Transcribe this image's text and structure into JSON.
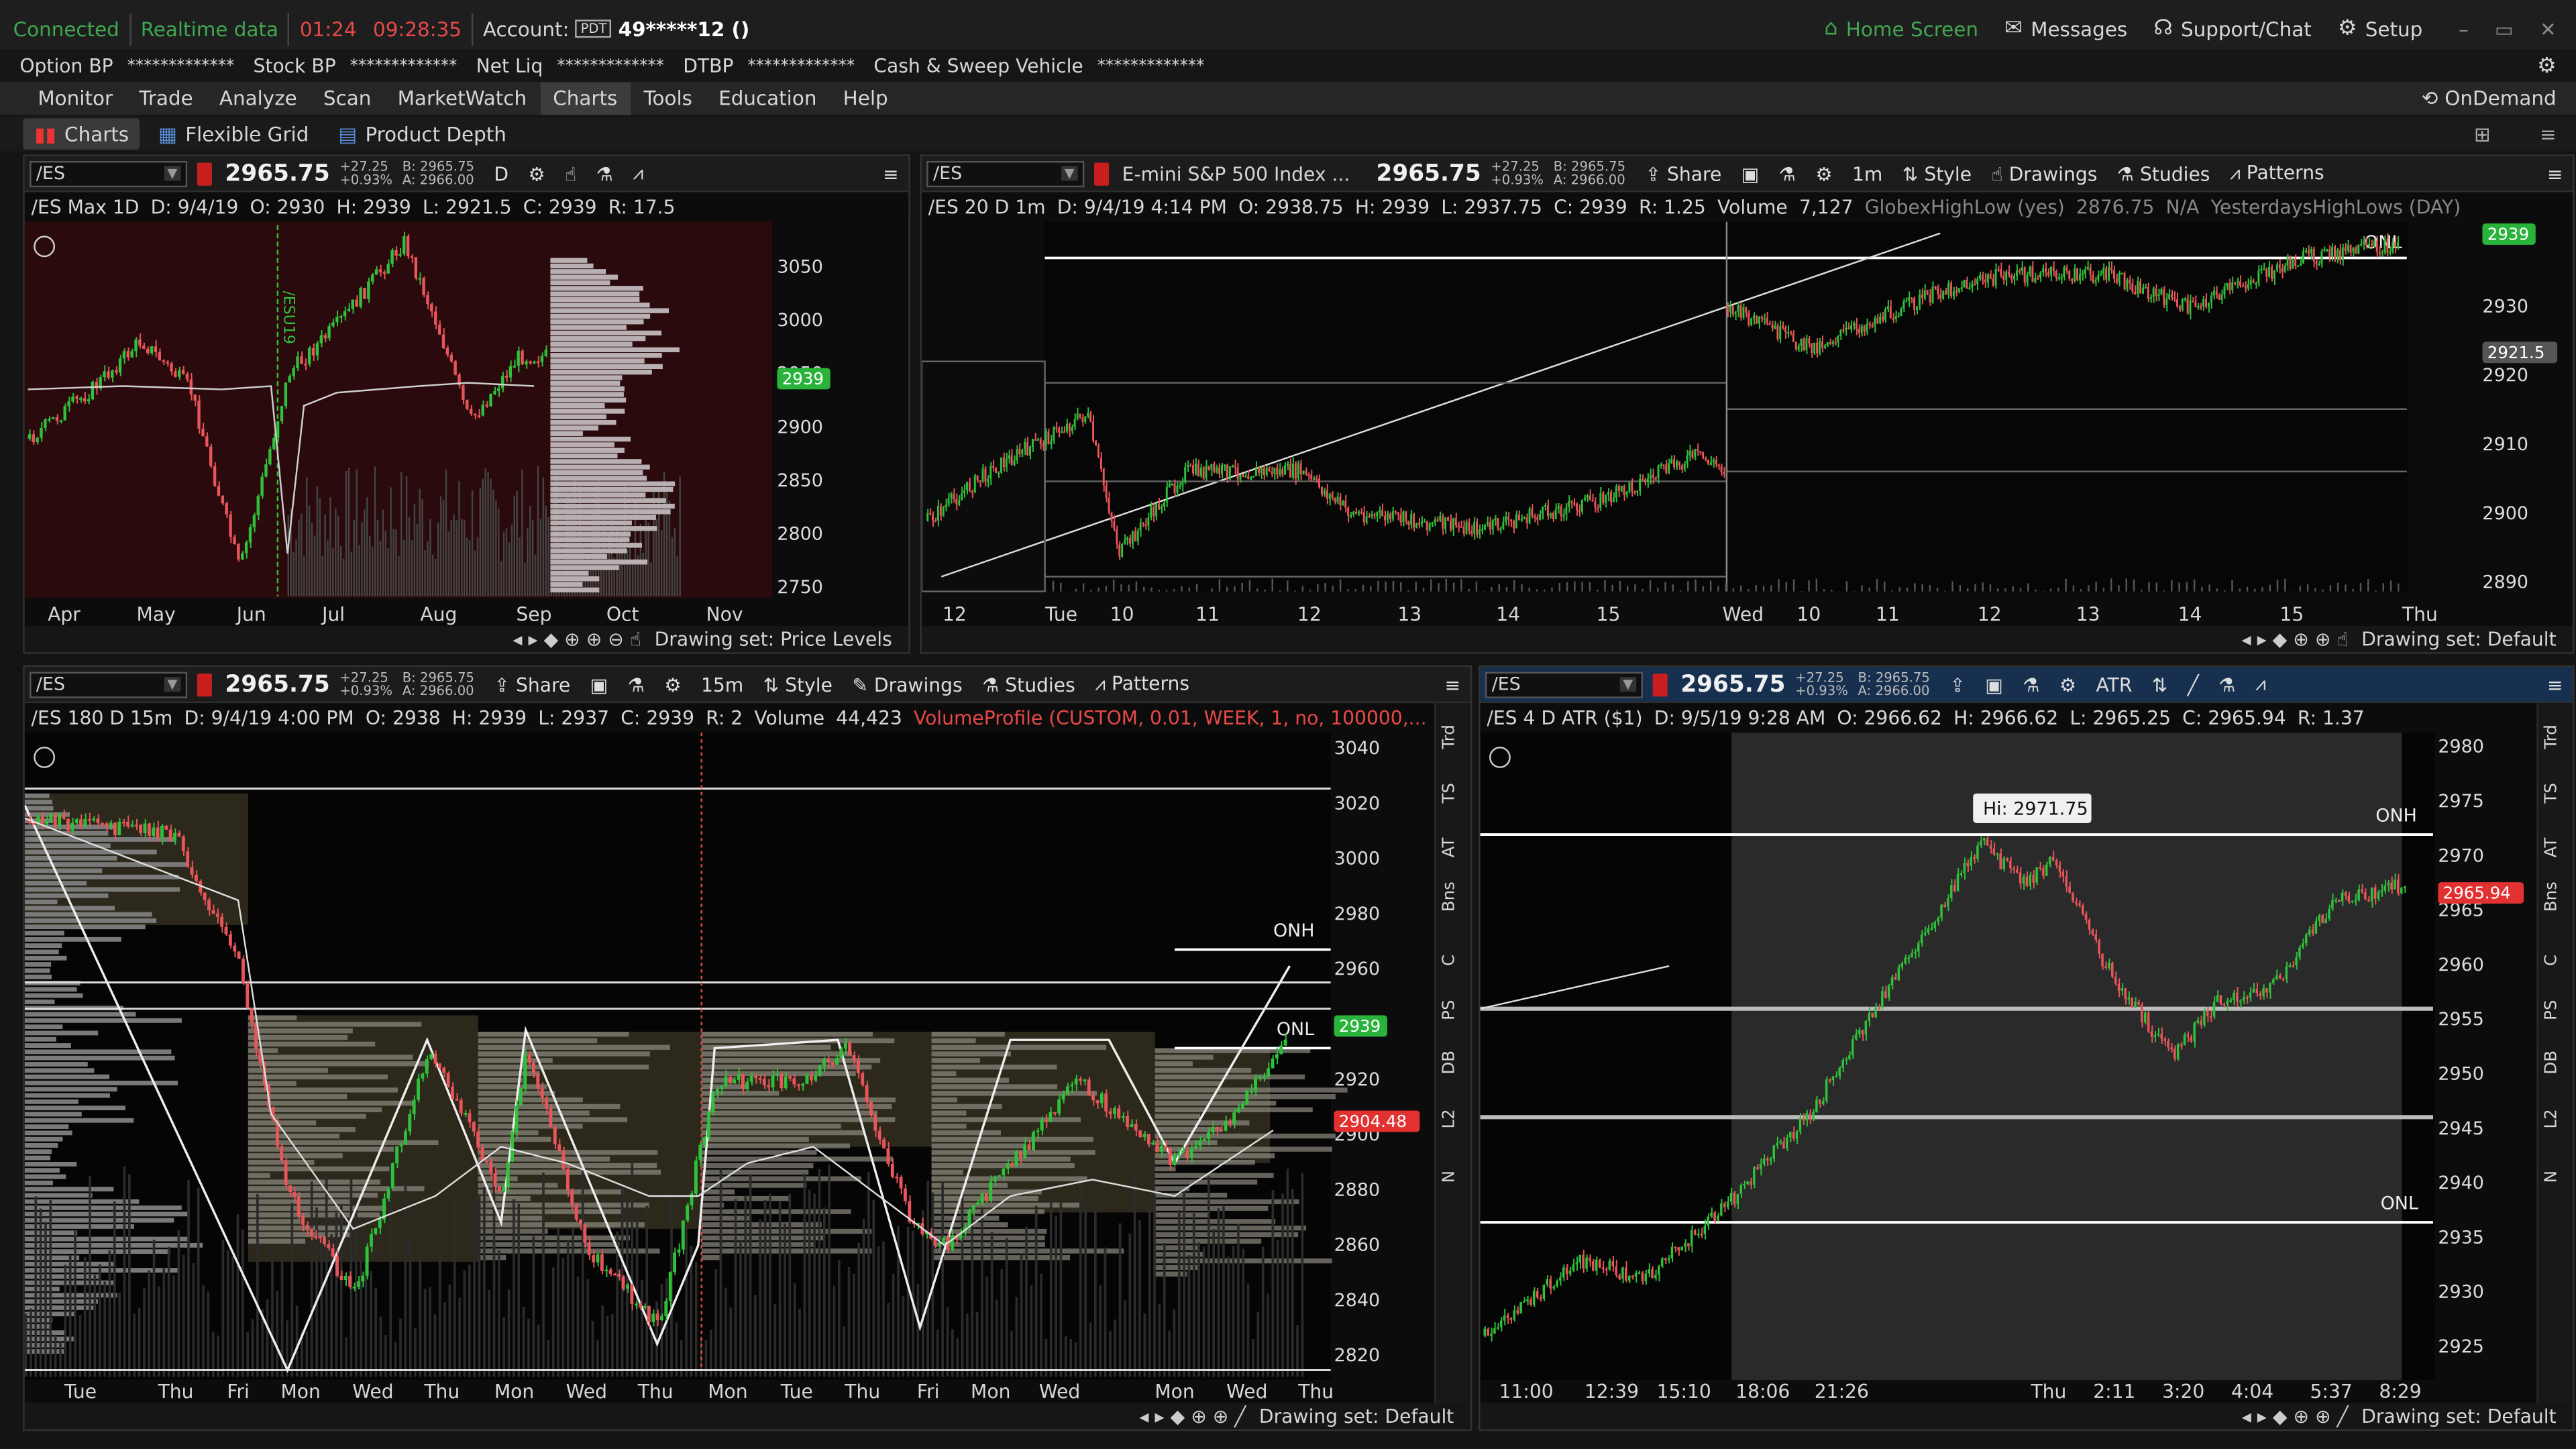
{
  "topbar": {
    "connected": "Connected",
    "realtime": "Realtime data",
    "t1": "01:24",
    "t2": "09:28:35",
    "account_label": "Account:",
    "account_badge": "PDT",
    "account_value": "49*****12 ()",
    "home": "Home Screen",
    "messages": "Messages",
    "support": "Support/Chat",
    "setup": "Setup"
  },
  "acct": {
    "optbp": "Option BP",
    "stockbp": "Stock BP",
    "netliq": "Net Liq",
    "dtbp": "DTBP",
    "cash": "Cash & Sweep Vehicle",
    "mask": "*************"
  },
  "menu": {
    "items": [
      "Monitor",
      "Trade",
      "Analyze",
      "Scan",
      "MarketWatch",
      "Charts",
      "Tools",
      "Education",
      "Help"
    ],
    "selected": "Charts",
    "ondemand": "OnDemand"
  },
  "sub": {
    "charts": "Charts",
    "flex": "Flexible Grid",
    "depth": "Product Depth"
  },
  "common": {
    "symbol": "/ES",
    "price": "2965.75",
    "chg1": "+27.25",
    "chg2": "+0.93%",
    "bid": "B: 2965.75",
    "ask": "A: 2966.00",
    "share": "Share",
    "style": "Style",
    "drawings": "Drawings",
    "studies": "Studies",
    "patterns": "Patterns",
    "drawset_default": "Drawing set: Default",
    "drawset_price": "Drawing set: Price Levels"
  },
  "p1": {
    "agg": "D",
    "info": [
      "/ES Max 1D",
      "D: 9/4/19",
      "O: 2930",
      "H: 2939",
      "L: 2921.5",
      "C: 2939",
      "R: 17.5"
    ],
    "yticks": [
      "3050",
      "3000",
      "2950",
      "2900",
      "2850",
      "2800",
      "2750"
    ],
    "cur": "2939",
    "xticks": [
      "Apr",
      "May",
      "Jun",
      "Jul",
      "Aug",
      "Sep",
      "Oct",
      "Nov"
    ],
    "vlabel": "/ESU19"
  },
  "p2": {
    "desc": "E-mini S&P 500 Index ...",
    "agg": "1m",
    "info": [
      "/ES 20 D 1m",
      "D: 9/4/19 4:14 PM",
      "O: 2938.75",
      "H: 2939",
      "L: 2937.75",
      "C: 2939",
      "R: 1.25",
      "Volume",
      "7,127",
      "GlobexHighLow (yes)",
      "2876.75",
      "N/A",
      "YesterdaysHighLows (DAY)"
    ],
    "yticks": [
      "2930",
      "2920",
      "2910",
      "2900",
      "2890"
    ],
    "cur": "2939",
    "lbl2": "2921.5",
    "onl": "ONL",
    "xticks": [
      "12",
      "Tue",
      "10",
      "11",
      "12",
      "13",
      "14",
      "15",
      "Wed",
      "10",
      "11",
      "12",
      "13",
      "14",
      "15",
      "Thu"
    ]
  },
  "p3": {
    "agg": "15m",
    "info": [
      "/ES 180 D 15m",
      "D: 9/4/19 4:00 PM",
      "O: 2938",
      "H: 2939",
      "L: 2937",
      "C: 2939",
      "R: 2",
      "Volume",
      "44,423"
    ],
    "vp": "VolumeProfile (CUSTOM, 0.01, WEEK, 1, no, 100000,...",
    "yticks": [
      "3040",
      "3020",
      "3000",
      "2980",
      "2960",
      "2940",
      "2920",
      "2900",
      "2880",
      "2860",
      "2840",
      "2820"
    ],
    "cur": "2939",
    "lbl2": "2904.48",
    "onh": "ONH",
    "onl": "ONL",
    "xticks": [
      "Tue",
      "Thu",
      "Fri",
      "Mon",
      "Wed",
      "Thu",
      "Mon",
      "Wed",
      "Thu",
      "Mon",
      "Tue",
      "Thu",
      "Fri",
      "Mon",
      "Wed",
      "Mon",
      "Wed",
      "Thu"
    ],
    "side": [
      "Trd",
      "TS",
      "AT",
      "Bns",
      "C",
      "PS",
      "DB",
      "L2",
      "N"
    ]
  },
  "p4": {
    "agg": "ATR",
    "info": [
      "/ES 4 D ATR ($1)",
      "D: 9/5/19 9:28 AM",
      "O: 2966.62",
      "H: 2966.62",
      "L: 2965.25",
      "C: 2965.94",
      "R: 1.37"
    ],
    "hi": "Hi: 2971.75",
    "yticks": [
      "2980",
      "2975",
      "2970",
      "2965",
      "2960",
      "2955",
      "2950",
      "2945",
      "2940",
      "2935",
      "2930",
      "2925"
    ],
    "cur": "2965.94",
    "onh": "ONH",
    "onl": "ONL",
    "xticks": [
      "11:00",
      "12:39",
      "15:10",
      "18:06",
      "21:26",
      "Thu",
      "2:11",
      "3:20",
      "4:04",
      "5:37",
      "8:29"
    ],
    "side": [
      "Trd",
      "TS",
      "AT",
      "Bns",
      "C",
      "PS",
      "DB",
      "L2",
      "N"
    ]
  },
  "colors": {
    "up": "#2fc13a",
    "down": "#e8555a",
    "green_label": "#29b33a",
    "red_label": "#e23131"
  }
}
